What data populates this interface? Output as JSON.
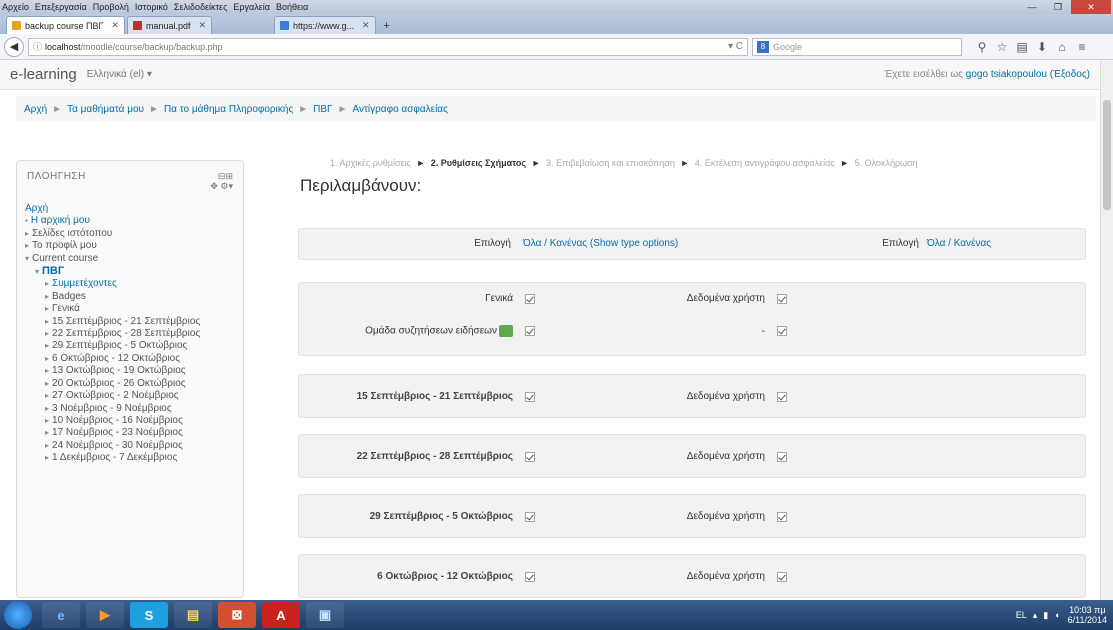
{
  "browser": {
    "menu": [
      "Αρχείο",
      "Επεξεργασία",
      "Προβολή",
      "Ιστορικό",
      "Σελιδοδείκτες",
      "Εργαλεία",
      "Βοήθεια"
    ],
    "tabs": [
      {
        "label": "backup course ПВГ",
        "active": true,
        "color": "#e8a020"
      },
      {
        "label": "manual.pdf",
        "active": false,
        "color": "#c03030"
      },
      {
        "label": "https://www.g...",
        "active": false,
        "color": "#3a7bd5"
      }
    ],
    "url_host": "localhost",
    "url_path": "/moodle/course/backup/backup.php",
    "search_placeholder": "Google"
  },
  "header": {
    "brand": "e-learning",
    "language": "Ελληνικά (el) ▾",
    "login_text": "Έχετε εισέλθει ως",
    "login_user": "gogo tsiakopoulou",
    "logout": "(Έξοδος)"
  },
  "breadcrumb": [
    "Αρχή",
    "Τα μαθήματά μου",
    "Πα το μάθημα Πληροφορικής",
    "ΠΒΓ",
    "Αντίγραφο ασφαλείας"
  ],
  "navblock": {
    "title": "ΠΛΟΗΓΗΣΗ",
    "ctrl_top": "⊟⊞",
    "ctrl_bottom": "✥ ⚙▾",
    "items": [
      {
        "text": "Αρχή",
        "link": true,
        "level": 0,
        "arrow": ""
      },
      {
        "text": "Η αρχική μου",
        "link": true,
        "level": 0,
        "arrow": "▪"
      },
      {
        "text": "Σελίδες ιστότοπου",
        "link": false,
        "level": 0,
        "arrow": "▸"
      },
      {
        "text": "Το προφίλ μου",
        "link": false,
        "level": 0,
        "arrow": "▸"
      },
      {
        "text": "Current course",
        "link": false,
        "level": 0,
        "arrow": "▾"
      },
      {
        "text": "ПВГ",
        "link": true,
        "level": 1,
        "arrow": "▾"
      },
      {
        "text": "Συμμετέχοντες",
        "link": true,
        "level": 2,
        "arrow": "▸"
      },
      {
        "text": "Badges",
        "link": false,
        "level": 2,
        "arrow": "▸"
      },
      {
        "text": "Γενικά",
        "link": false,
        "level": 2,
        "arrow": "▸"
      },
      {
        "text": "15 Σεπτέμβριος - 21 Σεπτέμβριος",
        "link": false,
        "level": 2,
        "arrow": "▸"
      },
      {
        "text": "22 Σεπτέμβριος - 28 Σεπτέμβριος",
        "link": false,
        "level": 2,
        "arrow": "▸"
      },
      {
        "text": "29 Σεπτέμβριος - 5 Οκτώβριος",
        "link": false,
        "level": 2,
        "arrow": "▸"
      },
      {
        "text": "6 Οκτώβριος - 12 Οκτώβριος",
        "link": false,
        "level": 2,
        "arrow": "▸"
      },
      {
        "text": "13 Οκτώβριος - 19 Οκτώβριος",
        "link": false,
        "level": 2,
        "arrow": "▸"
      },
      {
        "text": "20 Οκτώβριος - 26 Οκτώβριος",
        "link": false,
        "level": 2,
        "arrow": "▸"
      },
      {
        "text": "27 Οκτώβριος - 2 Νοέμβριος",
        "link": false,
        "level": 2,
        "arrow": "▸"
      },
      {
        "text": "3 Νοέμβριος - 9 Νοέμβριος",
        "link": false,
        "level": 2,
        "arrow": "▸"
      },
      {
        "text": "10 Νοέμβριος - 16 Νοέμβριος",
        "link": false,
        "level": 2,
        "arrow": "▸"
      },
      {
        "text": "17 Νοέμβριος - 23 Νοέμβριος",
        "link": false,
        "level": 2,
        "arrow": "▸"
      },
      {
        "text": "24 Νοέμβριος - 30 Νοέμβριος",
        "link": false,
        "level": 2,
        "arrow": "▸"
      },
      {
        "text": "1 Δεκέμβριος - 7 Δεκέμβριος",
        "link": false,
        "level": 2,
        "arrow": "▸"
      }
    ]
  },
  "steps": {
    "s1": "1. Αρχικές ρυθμίσεις",
    "s2": "2. Ρυθμίσεις Σχήματος",
    "s3": "3. Επιβεβαίωση και επισκόπηση",
    "s4": "4. Εκτέλεση αντιγράφου ασφαλείας",
    "s5": "5. Ολοκλήρωση",
    "arrow": "►"
  },
  "main": {
    "heading": "Περιλαμβάνουν:",
    "select_label": "Επιλογή",
    "select_link_1": "Όλα / Κανένας (Show type options)",
    "select_label_2": "Επιλογή",
    "select_link_2": "Όλα / Κανένας",
    "section0_title": "Γενικά",
    "section0_sub": "Ομάδα συζητήσεων ειδήσεων",
    "user_data": "Δεδομένα χρήστη",
    "dash": "-",
    "weeks": [
      "15 Σεπτέμβριος - 21 Σεπτέμβριος",
      "22 Σεπτέμβριος - 28 Σεπτέμβριος",
      "29 Σεπτέμβριος - 5 Οκτώβριος",
      "6 Οκτώβριος - 12 Οκτώβριος"
    ]
  },
  "taskbar": {
    "apps": [
      "e",
      "▶",
      "S",
      "▤",
      "⊠",
      "A",
      "▣"
    ],
    "lang": "EL",
    "time": "10:03 πμ",
    "date": "6/11/2014"
  }
}
